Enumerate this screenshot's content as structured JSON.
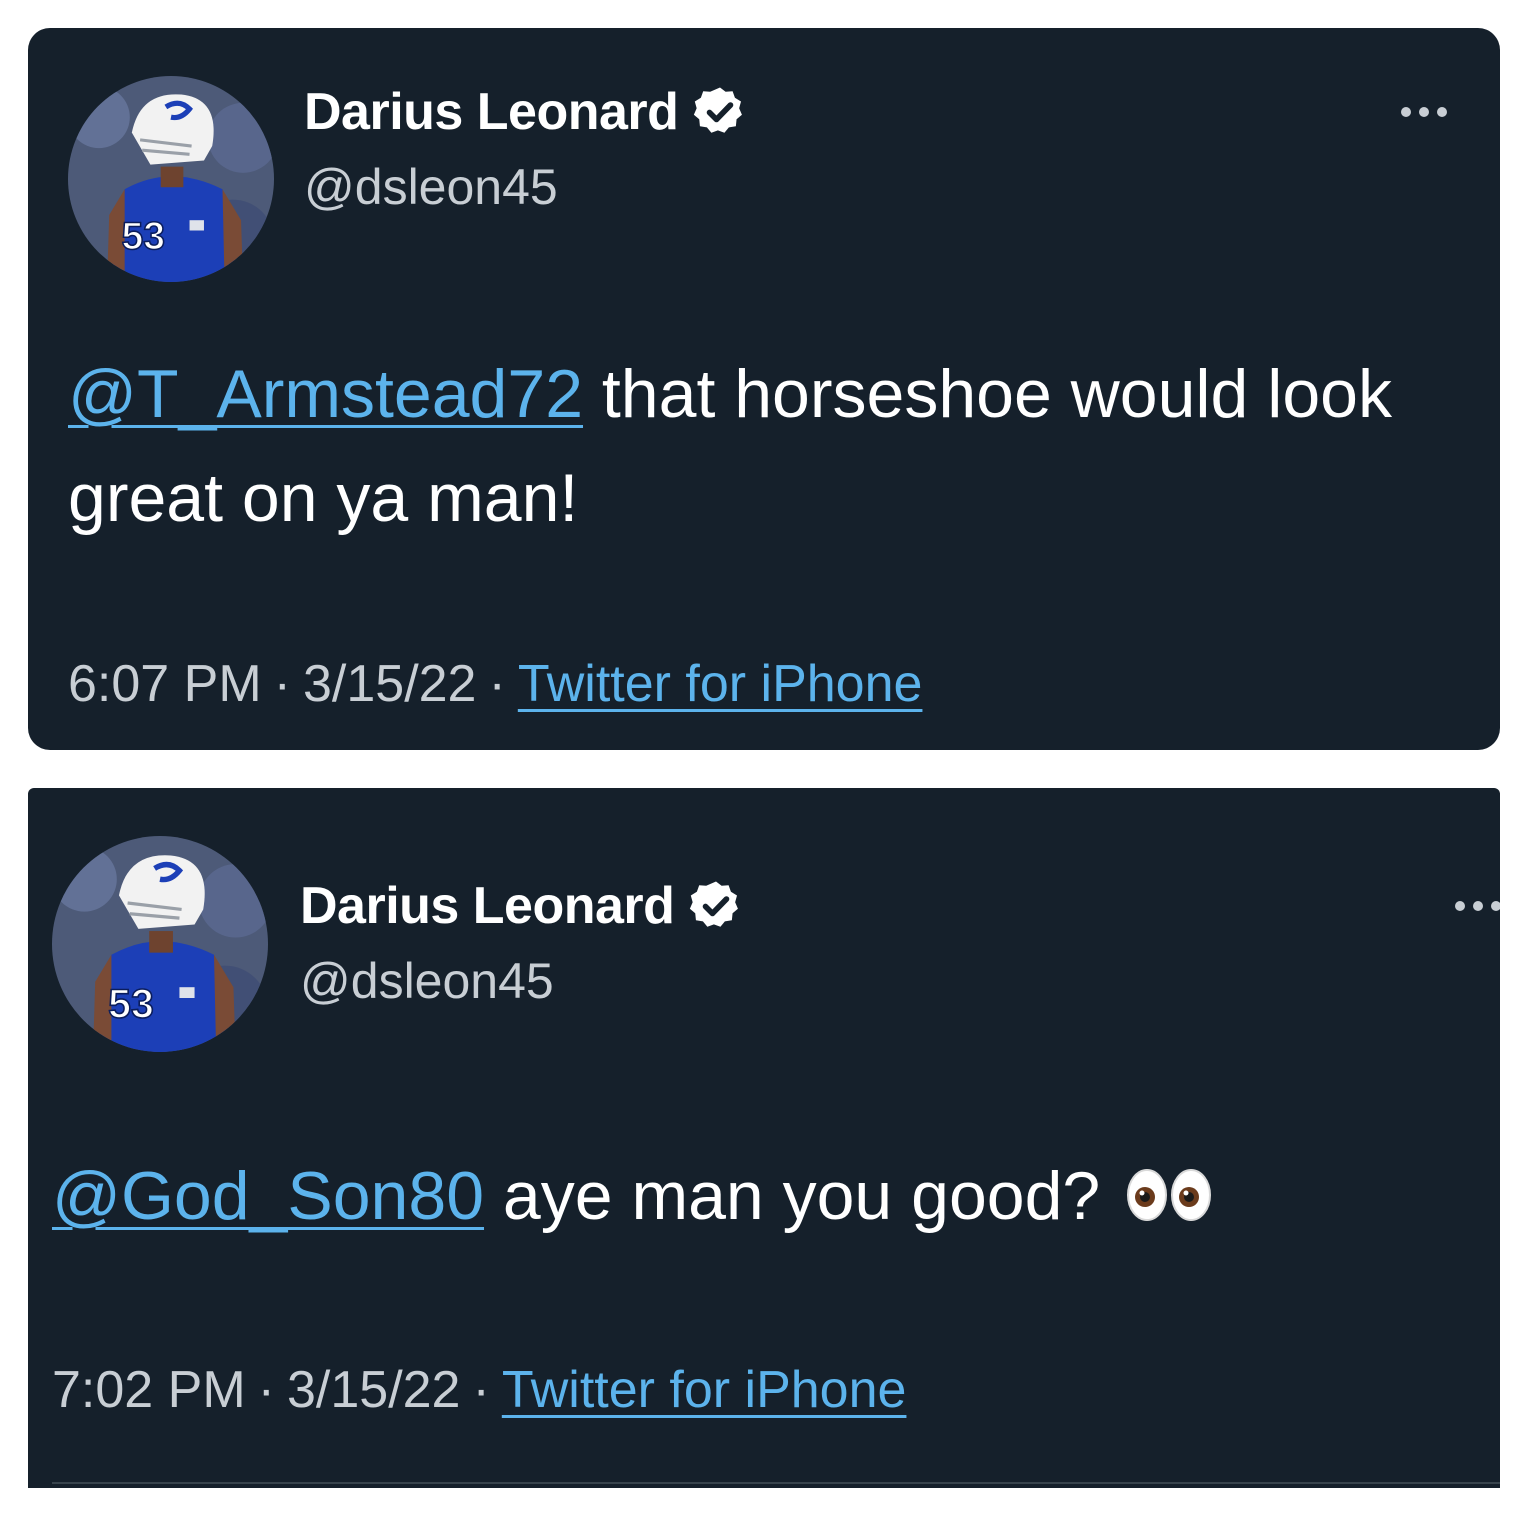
{
  "tweets": [
    {
      "author": {
        "display_name": "Darius Leonard",
        "handle": "@dsleon45",
        "verified": true,
        "avatar_jersey_number": "53"
      },
      "mention": "@T_Armstead72",
      "body": " that horseshoe would look great on ya man!",
      "time": "6:07 PM",
      "date": "3/15/22",
      "separator": "·",
      "source": "Twitter for iPhone"
    },
    {
      "author": {
        "display_name": "Darius Leonard",
        "handle": "@dsleon45",
        "verified": true,
        "avatar_jersey_number": "53"
      },
      "mention": "@God_Son80",
      "body": " aye man you good?",
      "emoji": "eyes-icon",
      "time": "7:02 PM",
      "date": "3/15/22",
      "separator": "·",
      "source": "Twitter for iPhone"
    }
  ],
  "colors": {
    "background": "#15202b",
    "text": "#ffffff",
    "secondary_text": "#c8ced4",
    "link": "#5cb3ec",
    "jersey_blue": "#1c3fb7"
  }
}
